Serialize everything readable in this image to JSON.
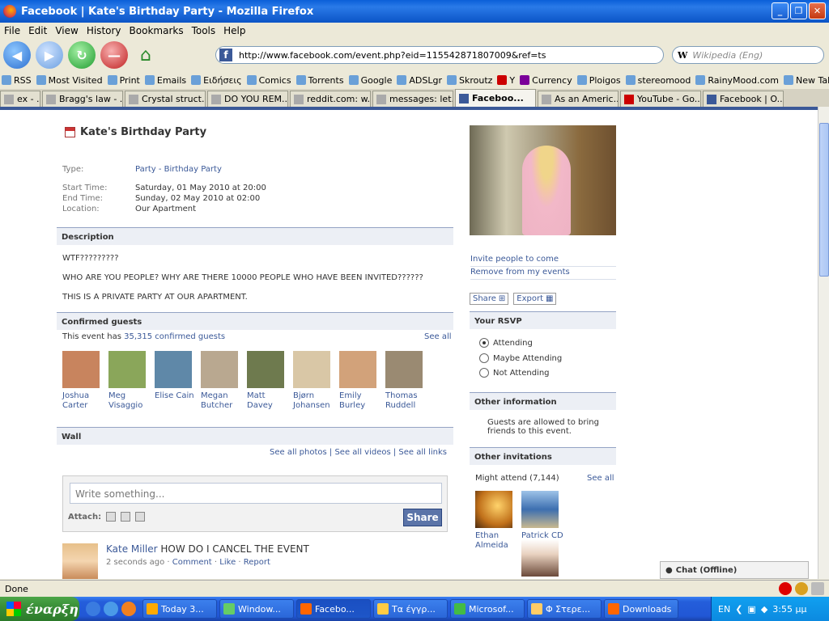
{
  "window": {
    "title": "Facebook | Kate's Birthday Party - Mozilla Firefox"
  },
  "menu": [
    "File",
    "Edit",
    "View",
    "History",
    "Bookmarks",
    "Tools",
    "Help"
  ],
  "url": "http://www.facebook.com/event.php?eid=115542871807009&ref=ts",
  "search_placeholder": "Wikipedia (Eng)",
  "bookmarks": [
    "RSS",
    "Most Visited",
    "Print",
    "Emails",
    "Ειδήσεις",
    "Comics",
    "Torrents",
    "Google",
    "ADSLgr",
    "Skroutz",
    "Y",
    "Currency",
    "Ploigos",
    "stereomood",
    "RainyMood.com",
    "New Tab"
  ],
  "tabs": [
    {
      "label": "ex - ..."
    },
    {
      "label": "Bragg's law - ..."
    },
    {
      "label": "Crystal struct..."
    },
    {
      "label": "DO YOU REM..."
    },
    {
      "label": "reddit.com: w..."
    },
    {
      "label": "messages: let..."
    },
    {
      "label": "Faceboo...",
      "active": true
    },
    {
      "label": "As an Americ..."
    },
    {
      "label": "YouTube - Go..."
    },
    {
      "label": "Facebook | O..."
    }
  ],
  "event": {
    "title": "Kate's Birthday Party",
    "type_label": "Type:",
    "type_value": "Party - Birthday Party",
    "start_label": "Start Time:",
    "start_value": "Saturday, 01 May 2010 at 20:00",
    "end_label": "End Time:",
    "end_value": "Sunday, 02 May 2010 at 02:00",
    "location_label": "Location:",
    "location_value": "Our Apartment"
  },
  "description": {
    "header": "Description",
    "line1": "WTF?????????",
    "line2": "WHO ARE YOU PEOPLE? WHY ARE THERE 10000 PEOPLE WHO HAVE BEEN INVITED??????",
    "line3": "THIS IS A PRIVATE PARTY AT OUR APARTMENT."
  },
  "guests": {
    "header": "Confirmed guests",
    "count_prefix": "This event has ",
    "count_link": "35,315 confirmed guests",
    "see_all": "See all",
    "list": [
      {
        "first": "Joshua",
        "last": "Carter",
        "color": "#c8845e"
      },
      {
        "first": "Meg",
        "last": "Visaggio",
        "color": "#8aa65a"
      },
      {
        "first": "Elise Cain",
        "last": "",
        "color": "#5f88a8"
      },
      {
        "first": "Megan",
        "last": "Butcher",
        "color": "#b9a890"
      },
      {
        "first": "Matt Davey",
        "last": "",
        "color": "#6e7a4e"
      },
      {
        "first": "Bjørn",
        "last": "Johansen",
        "color": "#d9c7a6"
      },
      {
        "first": "Emily",
        "last": "Burley",
        "color": "#d2a27a"
      },
      {
        "first": "Thomas",
        "last": "Ruddell",
        "color": "#9a8a72"
      }
    ]
  },
  "wall": {
    "header": "Wall",
    "links": "See all photos | See all videos | See all links",
    "placeholder": "Write something...",
    "attach_label": "Attach:",
    "share_label": "Share"
  },
  "post": {
    "name": "Kate Miller",
    "text": " HOW DO I CANCEL THE EVENT",
    "time": "2 seconds ago",
    "comment": "Comment",
    "like": "Like",
    "report": "Report"
  },
  "right": {
    "invite": "Invite people to come",
    "remove": "Remove from my events",
    "share_btn": "Share",
    "export_btn": "Export",
    "rsvp_header": "Your RSVP",
    "rsvp_options": [
      "Attending",
      "Maybe Attending",
      "Not Attending"
    ],
    "rsvp_selected": "Attending",
    "other_info_header": "Other information",
    "other_info_text1": "Guests are allowed to bring",
    "other_info_text2": "friends to this event.",
    "other_inv_header": "Other invitations",
    "might_attend": "Might attend (7,144)",
    "see_all": "See all",
    "invitees": [
      {
        "first": "Ethan",
        "last": "Almeida"
      },
      {
        "first": "Patrick CD",
        "last": ""
      }
    ],
    "chat": "Chat (Offline)"
  },
  "status": {
    "text": "Done"
  },
  "taskbar": {
    "start": "έναρξη",
    "tasks": [
      "Today 3...",
      "Window...",
      "Facebo...",
      "Τα έγγρ...",
      "Microsof...",
      "Φ Στερε...",
      "Downloads"
    ],
    "active_task": "Facebo...",
    "lang": "EN",
    "clock": "3:55 μμ"
  }
}
